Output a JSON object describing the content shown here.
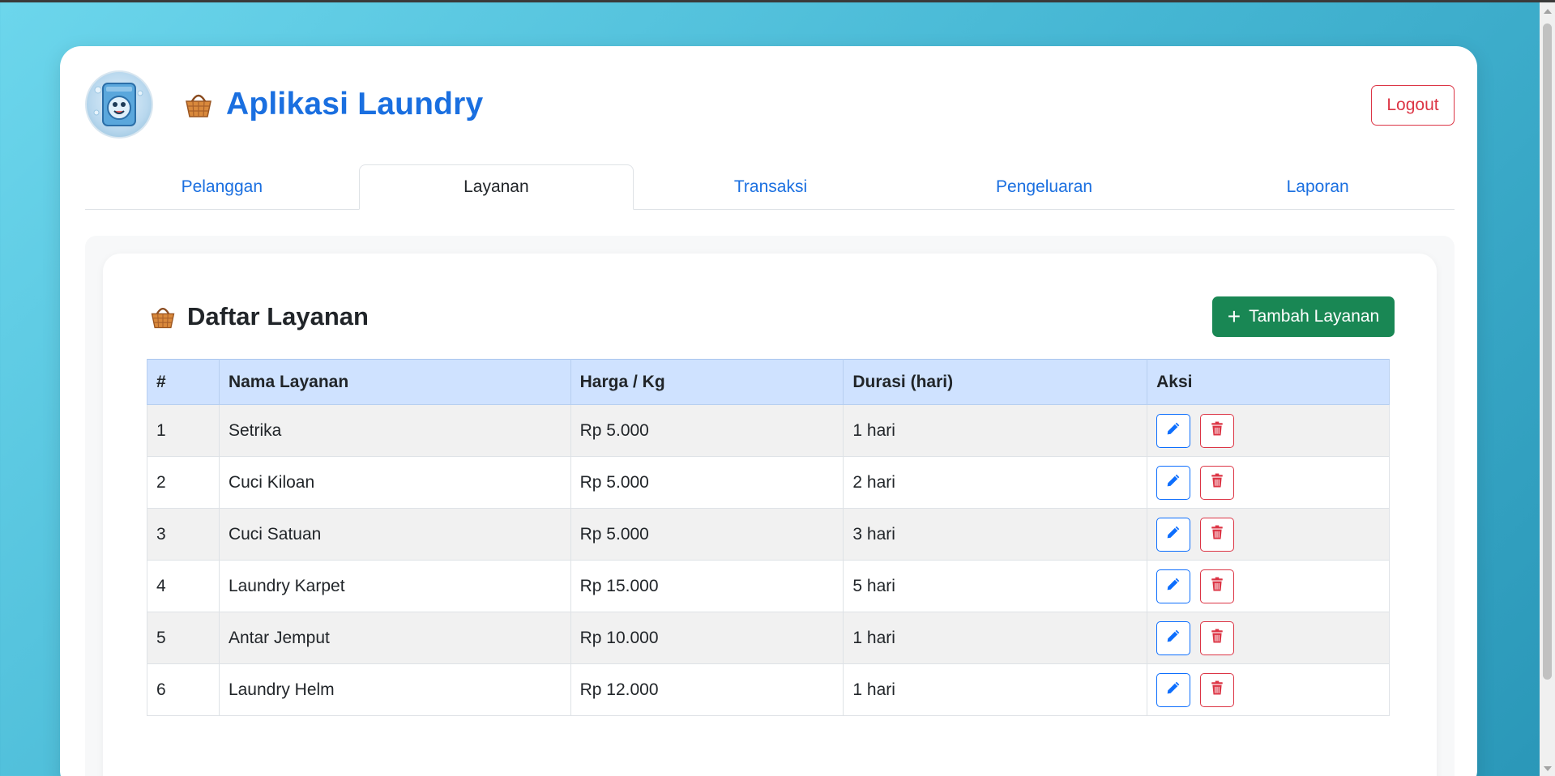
{
  "app": {
    "title": "Aplikasi Laundry",
    "logout_label": "Logout"
  },
  "tabs": [
    {
      "label": "Pelanggan",
      "active": false
    },
    {
      "label": "Layanan",
      "active": true
    },
    {
      "label": "Transaksi",
      "active": false
    },
    {
      "label": "Pengeluaran",
      "active": false
    },
    {
      "label": "Laporan",
      "active": false
    }
  ],
  "section": {
    "title": "Daftar Layanan",
    "add_label": "Tambah Layanan"
  },
  "table": {
    "headers": [
      "#",
      "Nama Layanan",
      "Harga / Kg",
      "Durasi (hari)",
      "Aksi"
    ],
    "rows": [
      {
        "no": "1",
        "name": "Setrika",
        "price": "Rp 5.000",
        "duration": "1 hari"
      },
      {
        "no": "2",
        "name": "Cuci Kiloan",
        "price": "Rp 5.000",
        "duration": "2 hari"
      },
      {
        "no": "3",
        "name": "Cuci Satuan",
        "price": "Rp 5.000",
        "duration": "3 hari"
      },
      {
        "no": "4",
        "name": "Laundry Karpet",
        "price": "Rp 15.000",
        "duration": "5 hari"
      },
      {
        "no": "5",
        "name": "Antar Jemput",
        "price": "Rp 10.000",
        "duration": "1 hari"
      },
      {
        "no": "6",
        "name": "Laundry Helm",
        "price": "Rp 12.000",
        "duration": "1 hari"
      }
    ]
  },
  "icons": {
    "logo": "laundry-mascot-logo",
    "title": "basket-icon",
    "add": "plus-icon",
    "edit": "pencil-icon",
    "delete": "trash-icon"
  },
  "colors": {
    "primary": "#1a6fe0",
    "danger": "#dc3545",
    "success": "#198754",
    "table_header": "#cfe2ff"
  }
}
